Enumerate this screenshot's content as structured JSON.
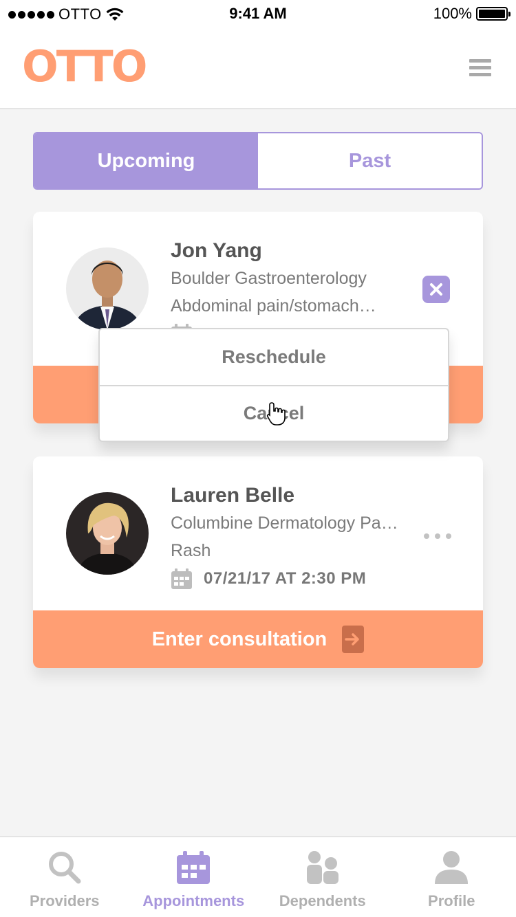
{
  "status_bar": {
    "carrier": "OTTO",
    "time": "9:41 AM",
    "battery": "100%"
  },
  "header": {
    "logo": "OTTO",
    "menu_icon": "hamburger-menu-icon"
  },
  "tabs": {
    "upcoming": "Upcoming",
    "past": "Past"
  },
  "appointments": [
    {
      "name": "Jon Yang",
      "practice": "Boulder Gastroenterology",
      "reason": "Abdominal pain/stomach…",
      "action_icon": "close-icon"
    },
    {
      "name": "Lauren Belle",
      "practice": "Columbine Dermatology Pa…",
      "reason": "Rash",
      "date": "07/21/17 AT 2:30 PM",
      "action_icon": "more-icon",
      "cta": "Enter consultation"
    }
  ],
  "dropdown": {
    "reschedule": "Reschedule",
    "cancel": "Cancel"
  },
  "tab_bar": {
    "providers": "Providers",
    "appointments": "Appointments",
    "dependents": "Dependents",
    "profile": "Profile"
  },
  "colors": {
    "accent": "#a796dc",
    "cta": "#ff9e73",
    "logo": "#ff9e73"
  }
}
